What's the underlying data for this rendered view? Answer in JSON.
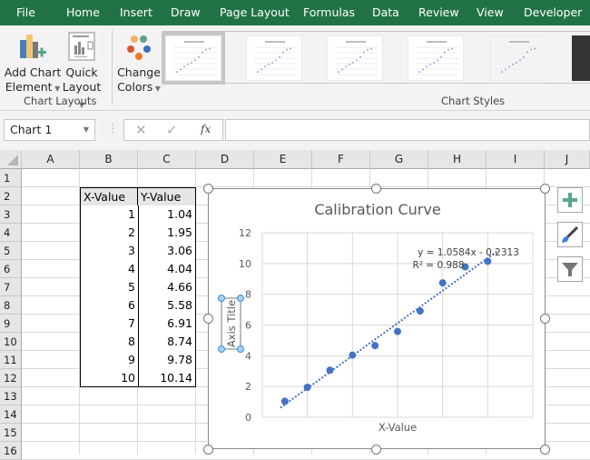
{
  "ribbon_tabs": [
    "File",
    "Home",
    "Insert",
    "Draw",
    "Page Layout",
    "Formulas",
    "Data",
    "Review",
    "View",
    "Developer"
  ],
  "ribbon": {
    "add_chart_element": [
      "Add Chart",
      "Element"
    ],
    "quick_layout": [
      "Quick",
      "Layout"
    ],
    "change_colors": [
      "Change",
      "Colors"
    ],
    "group_chart_layouts": "Chart Layouts",
    "group_chart_styles": "Chart Styles",
    "style_thumb_count": 6
  },
  "formula_bar": {
    "name_box": "Chart 1",
    "fx": "fx",
    "formula": ""
  },
  "columns": [
    "A",
    "B",
    "C",
    "D",
    "E",
    "F",
    "G",
    "H",
    "I",
    "J"
  ],
  "rows": [
    "1",
    "2",
    "3",
    "4",
    "5",
    "6",
    "7",
    "8",
    "9",
    "10",
    "11",
    "12",
    "13",
    "14",
    "15",
    "16"
  ],
  "table": {
    "headers": [
      "X-Value",
      "Y-Value"
    ],
    "x": [
      "1",
      "2",
      "3",
      "4",
      "5",
      "6",
      "7",
      "8",
      "9",
      "10"
    ],
    "y": [
      "1.04",
      "1.95",
      "3.06",
      "4.04",
      "4.66",
      "5.58",
      "6.91",
      "8.74",
      "9.78",
      "10.14"
    ]
  },
  "chart_data": {
    "type": "scatter",
    "title": "Calibration Curve",
    "xlabel": "X-Value",
    "ylabel": "Axis Title",
    "x": [
      1,
      2,
      3,
      4,
      5,
      6,
      7,
      8,
      9,
      10
    ],
    "y": [
      1.04,
      1.95,
      3.06,
      4.04,
      4.66,
      5.58,
      6.91,
      8.74,
      9.78,
      10.14
    ],
    "xlim": [
      0,
      12
    ],
    "ylim": [
      0,
      12
    ],
    "yticks": [
      "0",
      "2",
      "4",
      "6",
      "8",
      "10",
      "12"
    ],
    "grid": true,
    "trendline": {
      "type": "linear",
      "slope": 1.0584,
      "intercept": -0.2313,
      "equation": "y = 1.0584x - 0.2313",
      "r2": "R² = 0.988"
    },
    "series_color": "#4472c4"
  },
  "colors": {
    "accent": "#217346",
    "series": "#4472c4"
  }
}
